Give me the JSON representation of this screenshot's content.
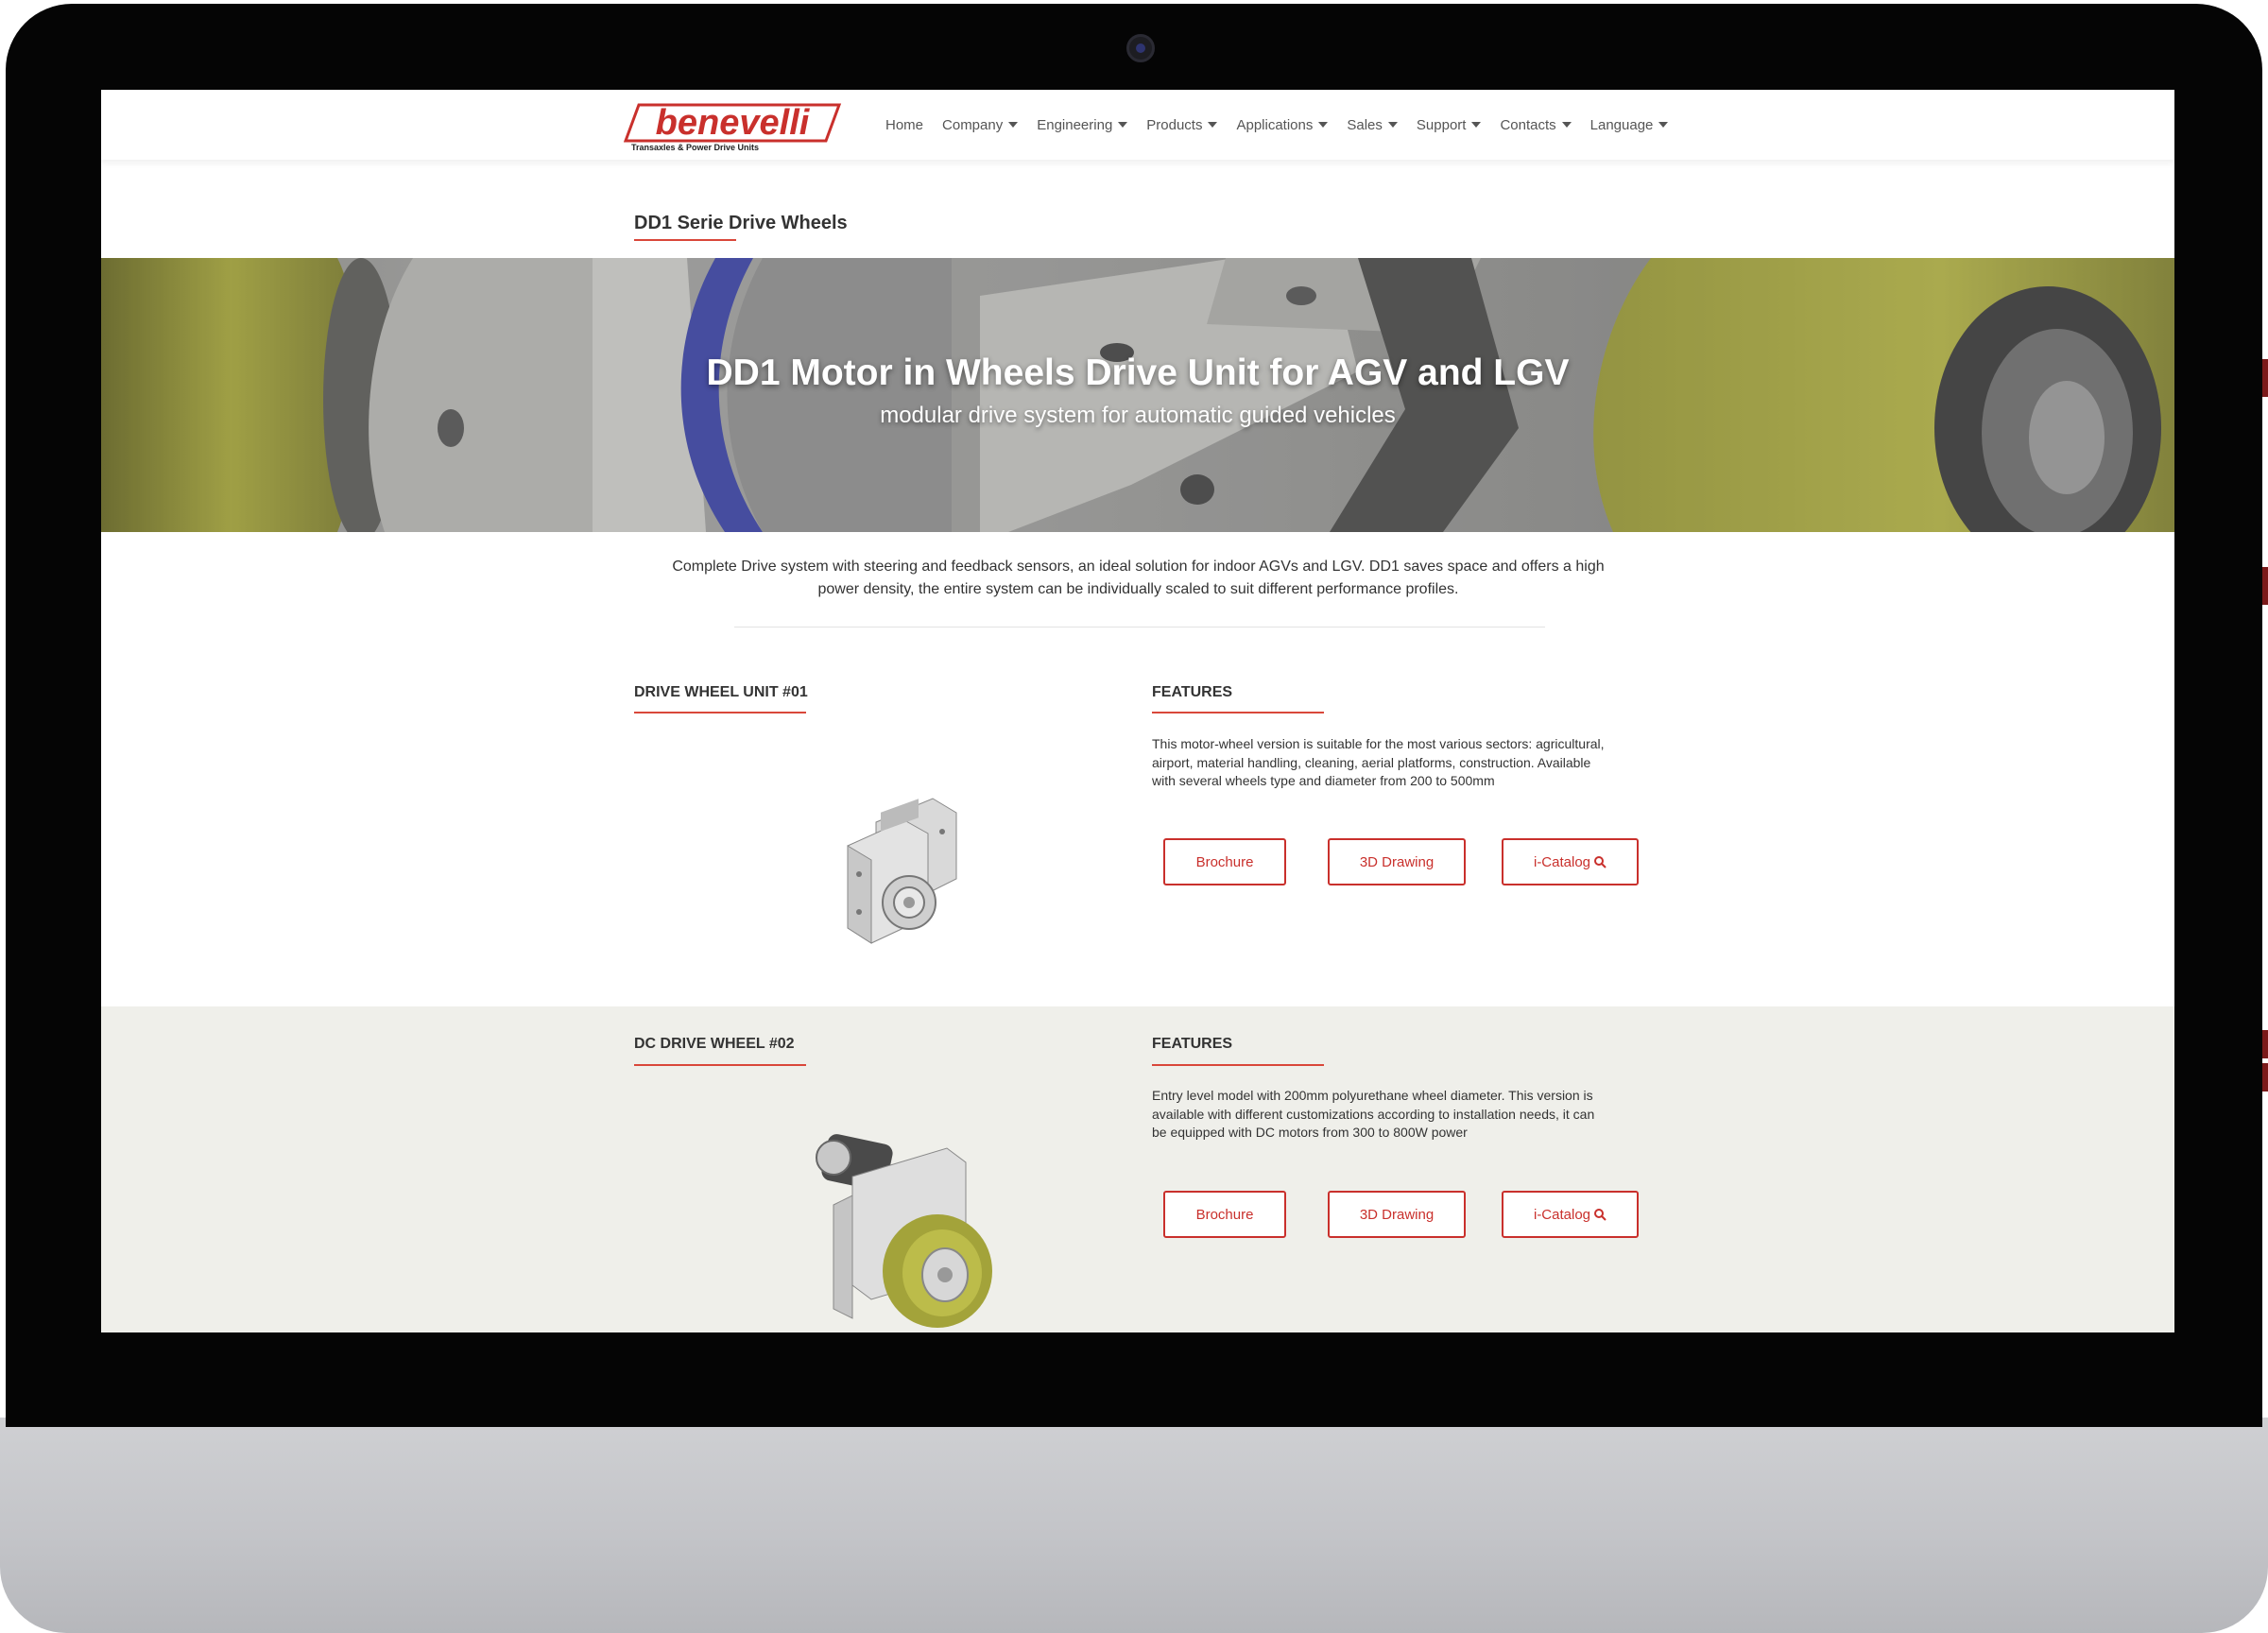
{
  "brand": {
    "name": "benevelli",
    "tagline": "Transaxles & Power Drive Units"
  },
  "nav": {
    "items": [
      {
        "label": "Home",
        "dropdown": false
      },
      {
        "label": "Company",
        "dropdown": true
      },
      {
        "label": "Engineering",
        "dropdown": true
      },
      {
        "label": "Products",
        "dropdown": true
      },
      {
        "label": "Applications",
        "dropdown": true
      },
      {
        "label": "Sales",
        "dropdown": true
      },
      {
        "label": "Support",
        "dropdown": true
      },
      {
        "label": "Contacts",
        "dropdown": true
      },
      {
        "label": "Language",
        "dropdown": true
      }
    ]
  },
  "page": {
    "title": "DD1 Serie Drive Wheels"
  },
  "hero": {
    "title": "DD1 Motor in Wheels Drive Unit for AGV and LGV",
    "subtitle": "modular drive system for automatic guided vehicles"
  },
  "intro": {
    "line1": "Complete Drive system with steering and feedback sensors, an ideal solution for indoor AGVs and LGV. DD1 saves space and offers a high",
    "line2": "power density, the entire system can be individually scaled to suit different performance profiles."
  },
  "products": [
    {
      "title": "DRIVE WHEEL UNIT #01",
      "features_heading": "FEATURES",
      "features_lines": [
        "This motor-wheel version is suitable for the most various sectors: agricultural,",
        "airport, material handling, cleaning, aerial platforms, construction. Available",
        "with several wheels type and  diameter from 200 to 500mm"
      ],
      "buttons": {
        "brochure": "Brochure",
        "drawing": "3D Drawing",
        "catalog": "i-Catalog"
      }
    },
    {
      "title": "DC DRIVE WHEEL #02",
      "features_heading": "FEATURES",
      "features_lines": [
        "Entry level model with 200mm polyurethane wheel diameter. This version is",
        "available with different customizations according to installation needs, it can",
        "be equipped with DC motors from 300 to 800W power"
      ],
      "buttons": {
        "brochure": "Brochure",
        "drawing": "3D Drawing",
        "catalog": "i-Catalog"
      }
    }
  ],
  "colors": {
    "accent": "#c9302c",
    "underline": "#d9473a",
    "alt_section_bg": "#efefea",
    "bezel": "#050505"
  },
  "icons": {
    "catalog": "magnifier-icon",
    "nav_dropdown": "caret-down-icon"
  }
}
